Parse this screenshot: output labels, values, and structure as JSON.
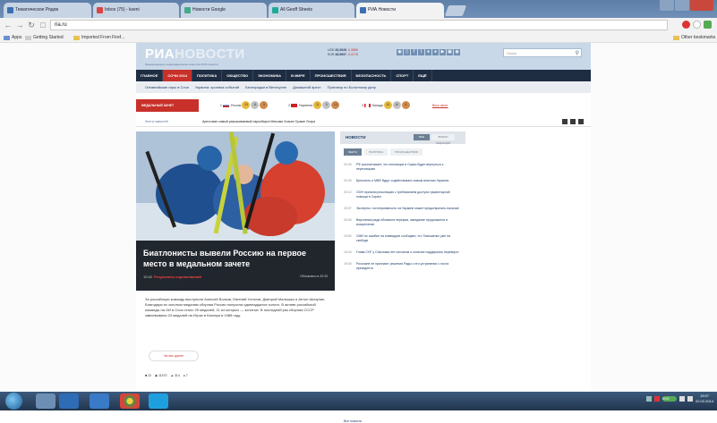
{
  "browser": {
    "tabs": [
      {
        "label": "Тематическое Рядов"
      },
      {
        "label": "Inbox (75) - kseni"
      },
      {
        "label": "Новости Google"
      },
      {
        "label": "All Geoff Sheets"
      },
      {
        "label": "РИА Новости"
      }
    ],
    "url": "ria.ru",
    "bookmarks": [
      "Apps",
      "Getting Started",
      "Imported From Firef..."
    ],
    "other_bookmarks": "Other bookmarks"
  },
  "site": {
    "logo_ria": "РИА",
    "logo_news": "НОВОСТИ",
    "tagline": "Международное информационное агентство РИА Новости",
    "rates": [
      {
        "label": "USD",
        "value": "35,3928",
        "delta": "-0,0856"
      },
      {
        "label": "EUR",
        "value": "48,5697",
        "delta": "-0,0178"
      }
    ],
    "search_placeholder": "Поиск",
    "nav": [
      "ГЛАВНОЕ",
      "СОЧИ 2014",
      "ПОЛИТИКА",
      "ОБЩЕСТВО",
      "ЭКОНОМИКА",
      "В МИРЕ",
      "ПРОИСШЕСТВИЯ",
      "БЕЗОПАСНОСТЬ",
      "СПОРТ",
      "ЕЩЁ"
    ],
    "subnav": [
      "Олимпийские игры в Сочи",
      "Украина: хроника событий",
      "Беспорядки в Венесуэле",
      "Домашний арест",
      "Приговор по Болотному делу"
    ],
    "medals": {
      "label": "МЕДАЛЬНЫЙ ЗАЧЕТ",
      "countries": [
        {
          "rank": "1",
          "name": "Россия",
          "gold": "13",
          "silver": "11",
          "bronze": "9"
        },
        {
          "rank": "2",
          "name": "Норвегия",
          "gold": "11",
          "silver": "5",
          "bronze": "10"
        },
        {
          "rank": "3",
          "name": "Канада",
          "gold": "10",
          "silver": "10",
          "bronze": "5"
        }
      ],
      "all_link": "Весь зачет"
    },
    "ticker": {
      "label": "Лента новостей",
      "text": "Арестован самый разыскиваемый наркобарон Мексики Хоакин Гусман Лоэра"
    },
    "hero": {
      "title": "Биатлонисты вывели Россию на первое место в медальном зачете",
      "time": "19:42",
      "rubric": "Результаты соревнований",
      "updated": "Обновлено в 20:33"
    },
    "lead": "За российскую команду выступили Алексей Волков, Евгений Устюгов, Дмитрий Малышко и Антон Шипулин. Благодаря их золотым медалям сборная России получила одиннадцатое золото. В активе российской команды на ОИ в Сочи стало 29 медалей, 11 из которых — золотые. В последний раз сборная СССР завоевывала 24 медалей на Играх в Калгари в 1988 году.",
    "read_button": "Читать далее",
    "stats": [
      "22",
      "11470",
      "314",
      "7"
    ],
    "news": {
      "title": "НОВОСТИ",
      "btn_all": "ВСЕ",
      "btn_main": "ВЫБОР РЕДАКЦИИ",
      "tabs": [
        "ЛЕНТА",
        "ПОЛИТИКА",
        "ПРОИСШЕСТВИЯ"
      ],
      "items": [
        {
          "time": "20:40",
          "text": "РФ рассчитывает, что оппозиция в Сирии будет вернуться к переговорам"
        },
        {
          "time": "20:30",
          "text": "Брюссель и МВФ будут содействовать новым властям Украины"
        },
        {
          "time": "20:12",
          "text": "ООН приняли резолюцию с требованием доступа гуманитарной помощи в Сирию"
        },
        {
          "time": "20:07",
          "text": "Эксперты: гостеприимность на Украине может предотвратить насилие"
        },
        {
          "time": "20:04",
          "text": "Верховная рада объявила перерыв, заседание продолжится в воскресенье"
        },
        {
          "time": "19:52",
          "text": "СМИ по ошибке на очевидцев сообщают, что Тимошенко уже на свободе"
        },
        {
          "time": "19:44",
          "text": "Глава СНГ у Союзника нет сигналов о попытке поддержать переворот"
        },
        {
          "time": "19:40",
          "text": "Россияне не признают решения Рады о его устранении с поста президента"
        }
      ],
      "all_link": "Все новости"
    }
  },
  "taskbar": {
    "lang": "ENG",
    "time": "19:57",
    "date": "22.02.2014"
  }
}
